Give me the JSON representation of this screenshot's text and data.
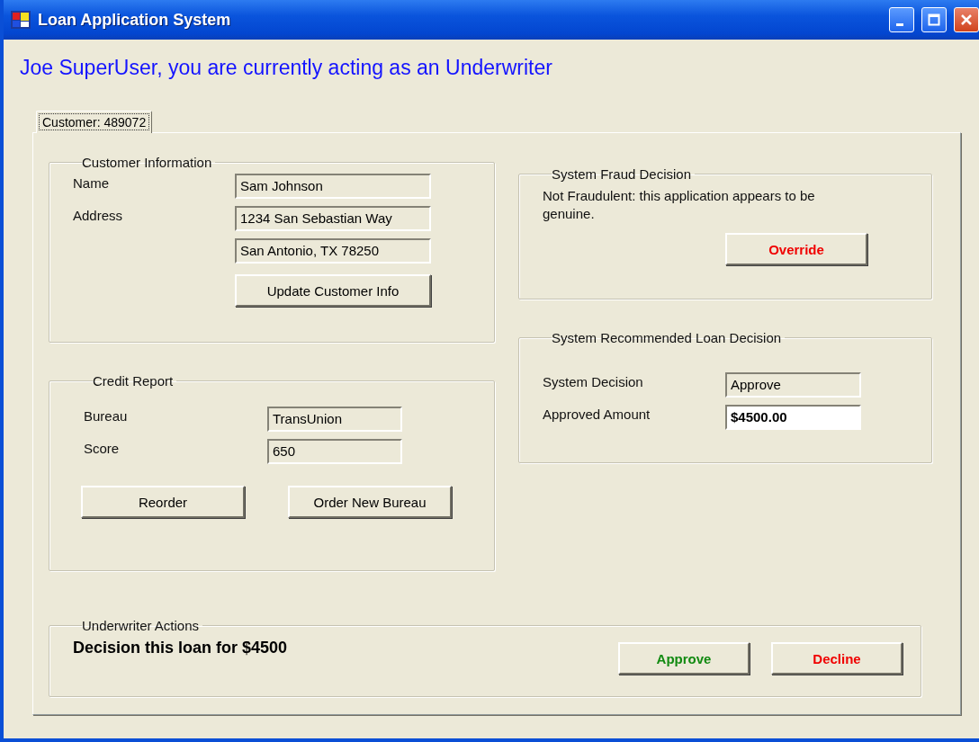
{
  "window": {
    "title": "Loan Application System"
  },
  "heading": "Joe SuperUser, you are currently acting as an Underwriter",
  "tabs": [
    {
      "label": "Customer: 489072",
      "selected": true
    }
  ],
  "customer_information": {
    "title": "Customer Information",
    "fields": [
      {
        "label": "Name",
        "value": "Sam Johnson",
        "readonly": true
      },
      {
        "label": "Address",
        "value": "1234 San Sebastian Way",
        "readonly": true
      },
      {
        "value": "San Antonio, TX 78250",
        "readonly": true
      }
    ],
    "button": {
      "label": "Update Customer Info",
      "kind": "plain"
    }
  },
  "credit_report": {
    "title": "Credit Report",
    "fields": [
      {
        "label": "Bureau",
        "value": "TransUnion",
        "readonly": true
      },
      {
        "label": "Score",
        "value": "650",
        "readonly": true
      }
    ],
    "buttons": [
      {
        "label": "Reorder",
        "kind": "plain"
      },
      {
        "label": "Order New Bureau",
        "kind": "plain"
      }
    ]
  },
  "fraud_decision": {
    "title": "System Fraud Decision",
    "message": "Not Fraudulent: this application appears to be genuine.",
    "button": {
      "label": "Override",
      "kind": "danger"
    }
  },
  "loan_decision": {
    "title": "System Recommended Loan Decision",
    "fields": [
      {
        "label": "System Decision",
        "value": "Approve",
        "readonly": true
      },
      {
        "label": "Approved Amount",
        "value": "$4500.00",
        "readonly": false
      }
    ]
  },
  "underwriter_actions": {
    "title": "Underwriter Actions",
    "message": "Decision this loan for $4500",
    "buttons": [
      {
        "label": "Approve",
        "kind": "success"
      },
      {
        "label": "Decline",
        "kind": "danger"
      }
    ]
  }
}
